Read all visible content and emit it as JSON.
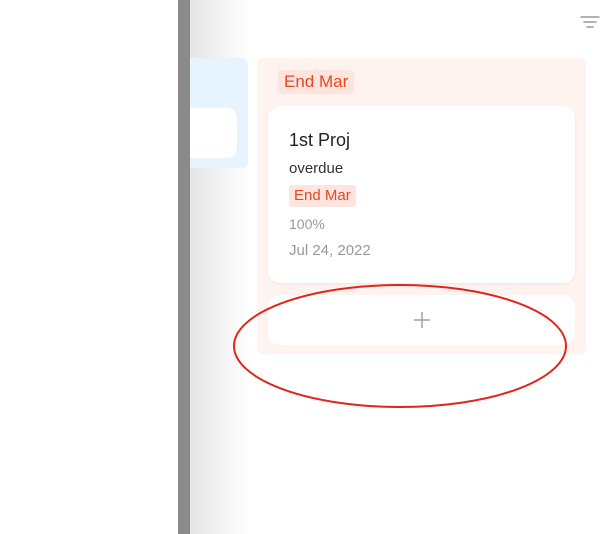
{
  "board": {
    "column": {
      "tag_label": "End Mar",
      "card": {
        "title": "1st Proj",
        "status": "overdue",
        "tag_label": "End Mar",
        "progress": "100%",
        "date": "Jul 24, 2022"
      },
      "add_icon": "plus-icon"
    },
    "filter_icon": "filter-icon"
  },
  "colors": {
    "column_bg": "#fff3f0",
    "tag_bg": "#fde4df",
    "tag_text": "#e8481f",
    "prev_column_bg": "#e8f4fd",
    "annotation": "#e0251b"
  }
}
